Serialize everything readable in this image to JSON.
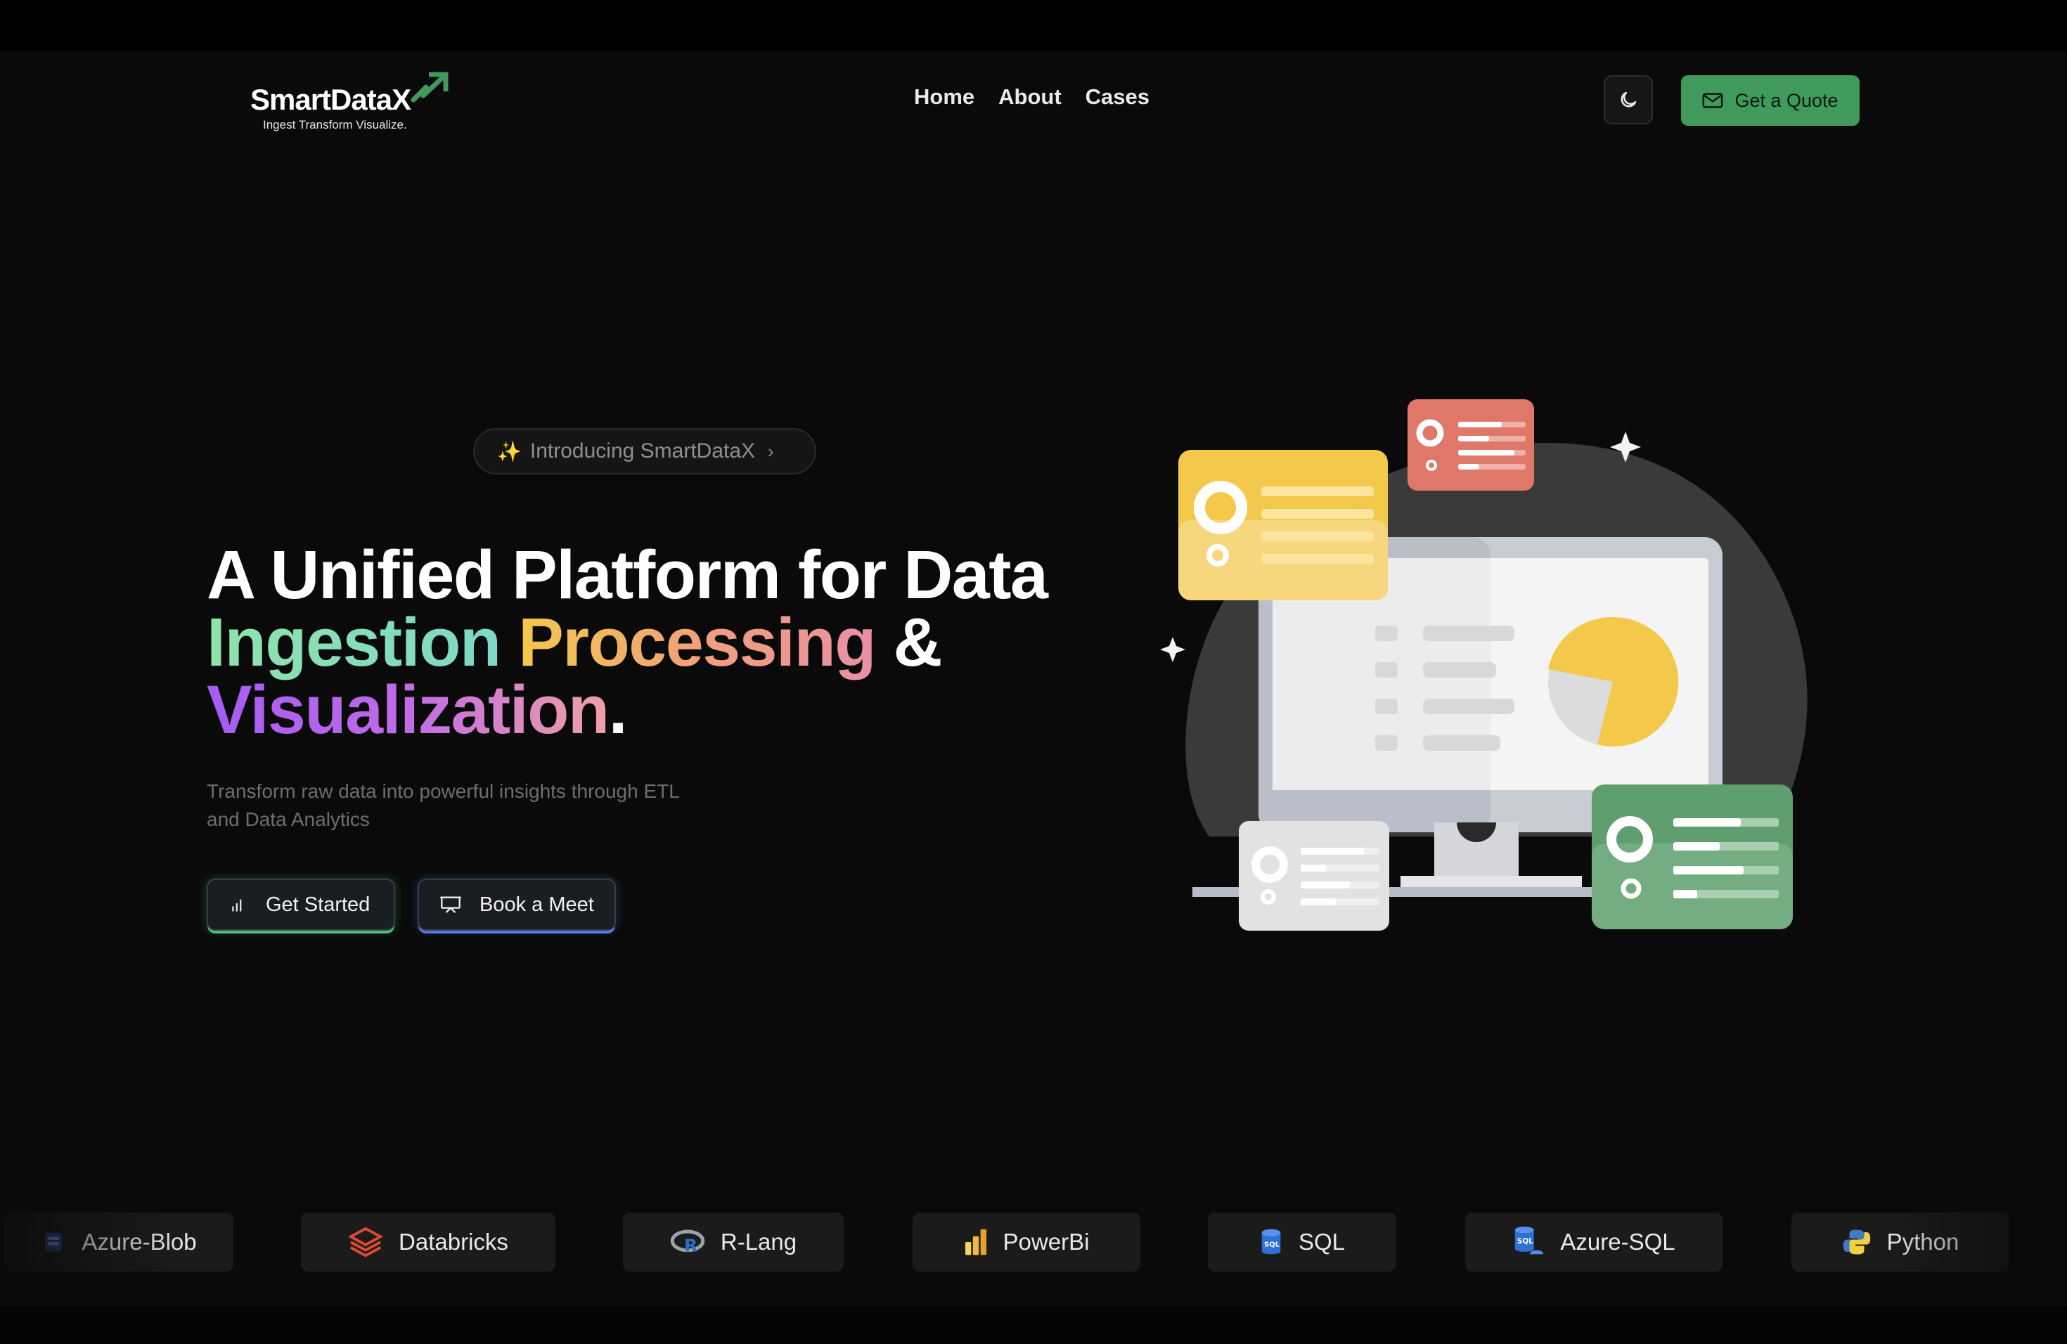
{
  "brand": {
    "name": "SmartDataX",
    "tagline": "Ingest Transform Visualize.",
    "accent": "#3f9a5b"
  },
  "nav": {
    "items": [
      {
        "label": "Home"
      },
      {
        "label": "About"
      },
      {
        "label": "Cases"
      }
    ]
  },
  "header": {
    "theme_icon": "moon-icon",
    "quote_label": "Get a Quote",
    "quote_icon": "mail-icon"
  },
  "hero": {
    "pill_label": "Introducing SmartDataX",
    "title_line1": "A Unified Platform for Data",
    "title_ingestion": "Ingestion",
    "title_processing": "Processing",
    "title_amp": "&",
    "title_visualization": "Visualization",
    "title_period": ".",
    "subtitle": "Transform raw data into powerful insights through ETL and Data Analytics",
    "cta_start": "Get Started",
    "cta_meet": "Book a Meet"
  },
  "tech": {
    "items": [
      {
        "label": "Azure-Blob",
        "icon": "azure-blob-icon"
      },
      {
        "label": "Databricks",
        "icon": "databricks-icon"
      },
      {
        "label": "R-Lang",
        "icon": "r-lang-icon"
      },
      {
        "label": "PowerBi",
        "icon": "powerbi-icon"
      },
      {
        "label": "SQL",
        "icon": "sql-icon"
      },
      {
        "label": "Azure-SQL",
        "icon": "azure-sql-icon"
      },
      {
        "label": "Python",
        "icon": "python-icon"
      }
    ]
  },
  "colors": {
    "ingestion": "#8ee3a8",
    "processing": "#f3c84b",
    "visualization": "#a45cf3",
    "card_yellow": "#f3c84b",
    "card_red": "#e0786a",
    "card_green": "#5f9e6e"
  }
}
